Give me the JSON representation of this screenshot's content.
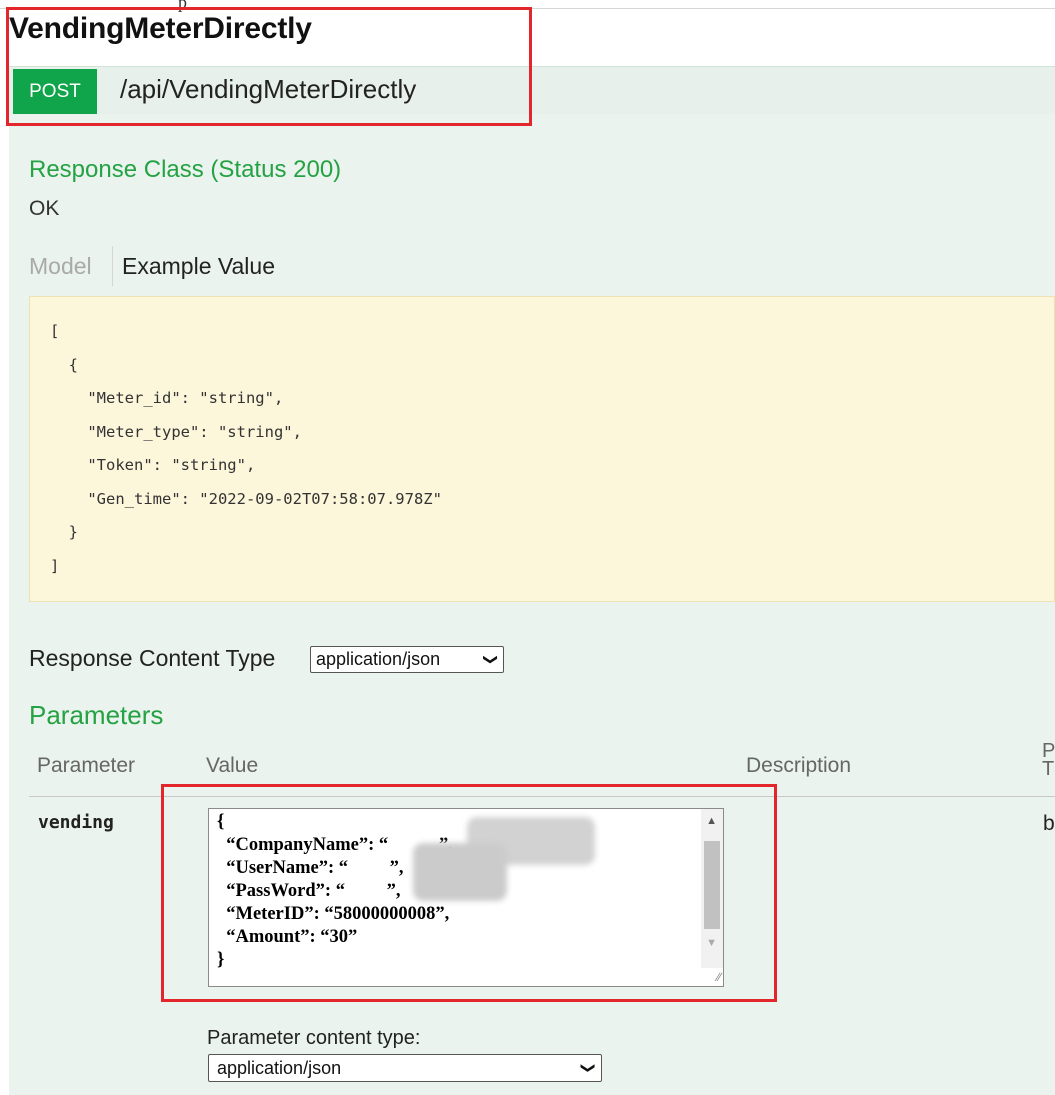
{
  "top_cut_text": "p",
  "operation": {
    "title": "VendingMeterDirectly",
    "method": "POST",
    "path": "/api/VendingMeterDirectly"
  },
  "response": {
    "heading": "Response Class (Status 200)",
    "status_text": "OK",
    "tabs": {
      "model": "Model",
      "example": "Example Value"
    },
    "example_json": "[\n  {\n    \"Meter_id\": \"string\",\n    \"Meter_type\": \"string\",\n    \"Token\": \"string\",\n    \"Gen_time\": \"2022-09-02T07:58:07.978Z\"\n  }\n]",
    "content_type_label": "Response Content Type",
    "content_type_value": "application/json"
  },
  "parameters": {
    "heading": "Parameters",
    "columns": [
      "Parameter",
      "Value",
      "Description",
      "Parameter Type"
    ],
    "column_cut_label": "P\nT",
    "rows": [
      {
        "name": "vending",
        "type_cut": "b",
        "value": "{\n  “CompanyName”: “           ”,\n  “UserName”: “         ”,\n  “PassWord”: “         ”,\n  “MeterID”: “58000000008”,\n  “Amount”: “30”\n}"
      }
    ],
    "content_type_label": "Parameter content type:",
    "content_type_value": "application/json"
  },
  "colors": {
    "post": "#10a54a",
    "panel": "#eaf3ed",
    "accent_green": "#24a244",
    "highlight_red": "#e2262b",
    "code_bg": "#fcf6db"
  }
}
